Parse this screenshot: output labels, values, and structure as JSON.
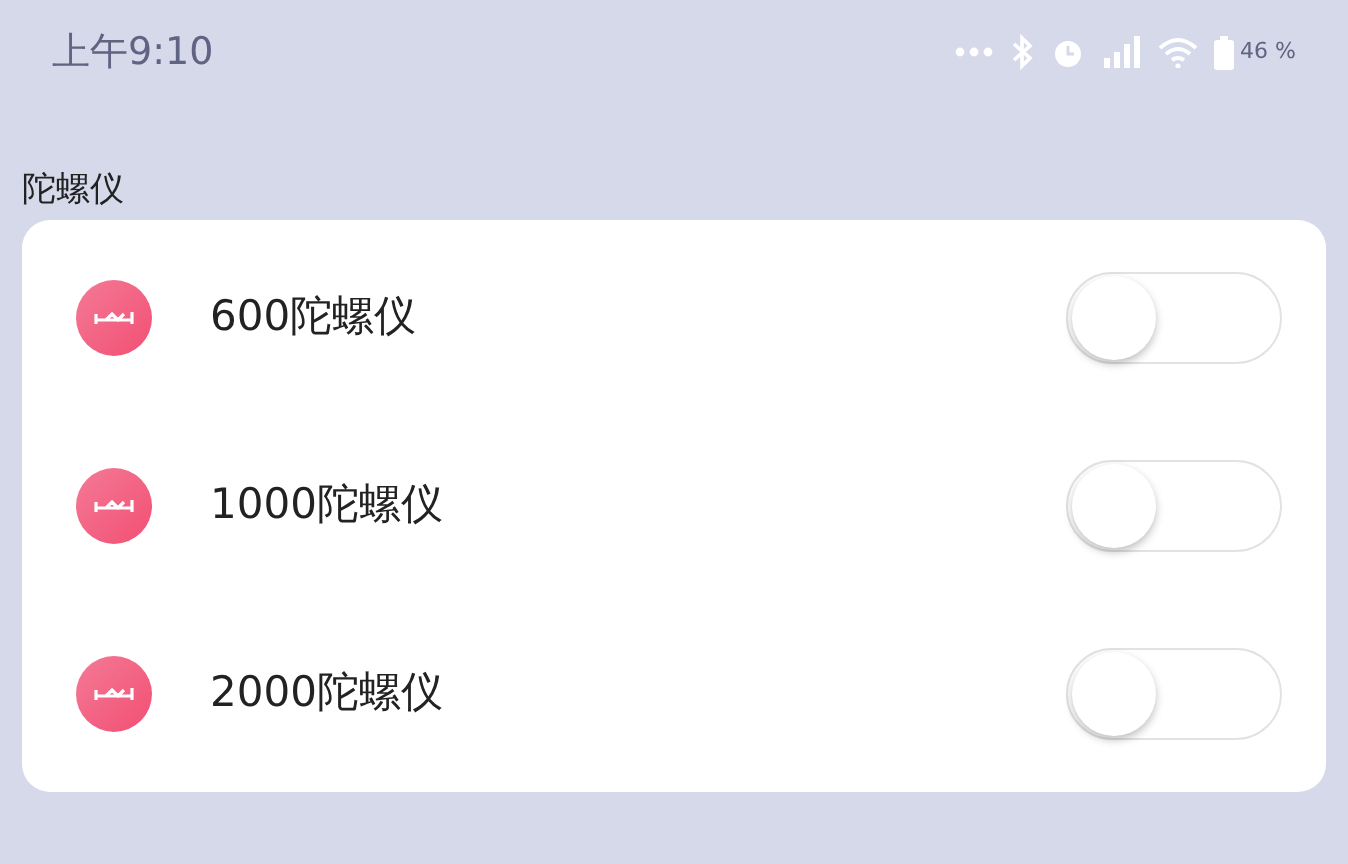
{
  "status_bar": {
    "time": "上午9:10",
    "battery": "46 %"
  },
  "section": {
    "title": "陀螺仪"
  },
  "items": [
    {
      "label": "600陀螺仪",
      "on": false
    },
    {
      "label": "1000陀螺仪",
      "on": false
    },
    {
      "label": "2000陀螺仪",
      "on": false
    }
  ]
}
